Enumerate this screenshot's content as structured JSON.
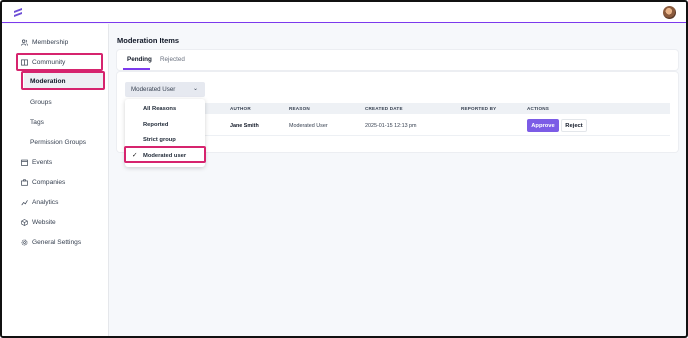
{
  "sidebar": {
    "items": [
      {
        "label": "Membership",
        "icon": "users-icon"
      },
      {
        "label": "Community",
        "icon": "book-icon"
      },
      {
        "label": "Moderation"
      },
      {
        "label": "Groups"
      },
      {
        "label": "Tags"
      },
      {
        "label": "Permission Groups"
      },
      {
        "label": "Events",
        "icon": "calendar-icon"
      },
      {
        "label": "Companies",
        "icon": "briefcase-icon"
      },
      {
        "label": "Analytics",
        "icon": "chart-icon"
      },
      {
        "label": "Website",
        "icon": "cube-icon"
      },
      {
        "label": "General Settings",
        "icon": "gear-icon"
      }
    ]
  },
  "page": {
    "title": "Moderation Items"
  },
  "tabs": [
    {
      "label": "Pending"
    },
    {
      "label": "Rejected"
    }
  ],
  "filter": {
    "selected": "Moderated User",
    "options": [
      "All Reasons",
      "Reported",
      "Strict group",
      "Moderated user"
    ],
    "checked_option": "Moderated user"
  },
  "table": {
    "headers": [
      "AUTHOR",
      "REASON",
      "CREATED DATE",
      "REPORTED BY",
      "ACTIONS"
    ],
    "rows": [
      {
        "author": "Jane Smith",
        "reason": "Moderated User",
        "created": "2025-01-15 12:13 pm",
        "reported_by": ""
      }
    ],
    "approve_label": "Approve",
    "reject_label": "Reject"
  },
  "colors": {
    "accent": "#7c3aed",
    "approve": "#7c5ce6",
    "highlight": "#d6246e"
  }
}
